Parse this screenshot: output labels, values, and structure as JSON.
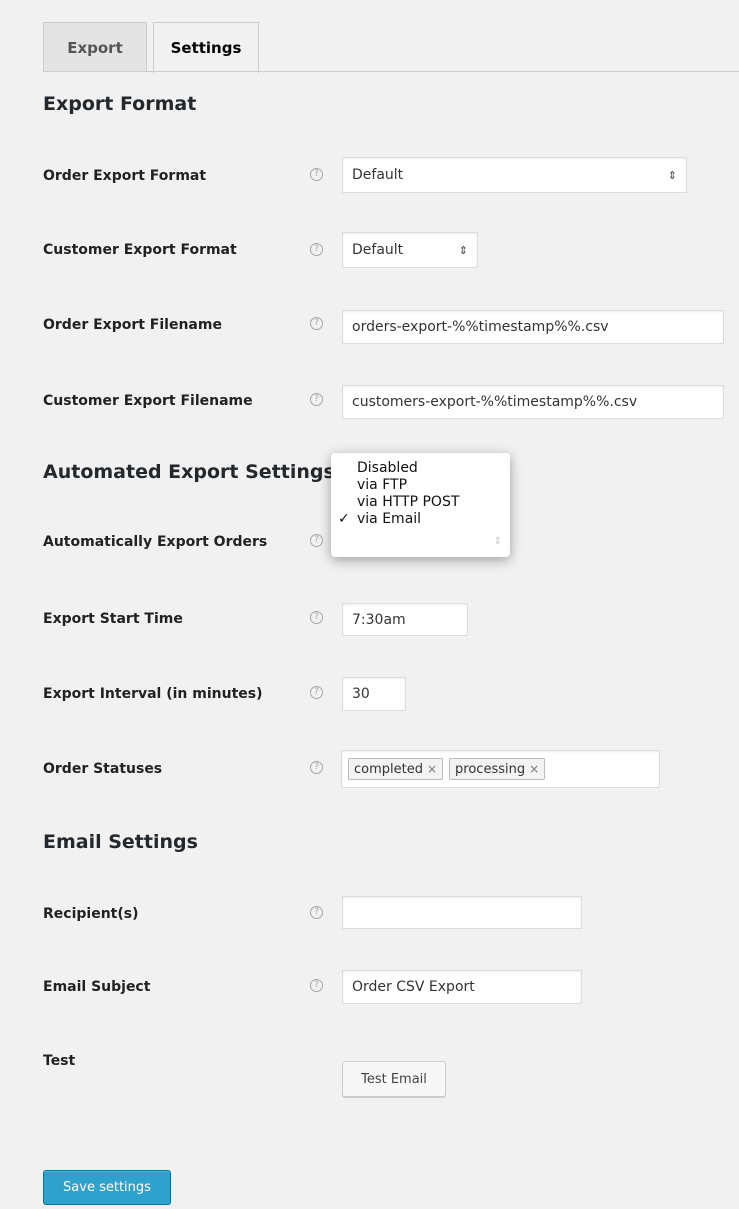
{
  "tabs": [
    {
      "label": "Export"
    },
    {
      "label": "Settings"
    }
  ],
  "sections": {
    "export_format": "Export Format",
    "automated": "Automated Export Settings",
    "email": "Email Settings"
  },
  "fields": {
    "order_export_format": {
      "label": "Order Export Format",
      "value": "Default"
    },
    "customer_export_format": {
      "label": "Customer Export Format",
      "value": "Default"
    },
    "order_export_filename": {
      "label": "Order Export Filename",
      "value": "orders-export-%%timestamp%%.csv"
    },
    "customer_export_filename": {
      "label": "Customer Export Filename",
      "value": "customers-export-%%timestamp%%.csv"
    },
    "auto_export_orders": {
      "label": "Automatically Export Orders",
      "options": [
        "Disabled",
        "via FTP",
        "via HTTP POST",
        "via Email"
      ],
      "selected": "via Email"
    },
    "export_start_time": {
      "label": "Export Start Time",
      "value": "7:30am"
    },
    "export_interval": {
      "label": "Export Interval (in minutes)",
      "value": "30"
    },
    "order_statuses": {
      "label": "Order Statuses",
      "tags": [
        "completed",
        "processing"
      ]
    },
    "recipients": {
      "label": "Recipient(s)",
      "value": ""
    },
    "email_subject": {
      "label": "Email Subject",
      "value": "Order CSV Export"
    },
    "test": {
      "label": "Test",
      "button": "Test Email"
    }
  },
  "save_button": "Save settings",
  "icons": {
    "help": "help-circle-icon",
    "check": "✓",
    "remove": "×",
    "updown": "⇕"
  },
  "colors": {
    "primary": "#2ea2cc",
    "background": "#f1f1f1"
  }
}
